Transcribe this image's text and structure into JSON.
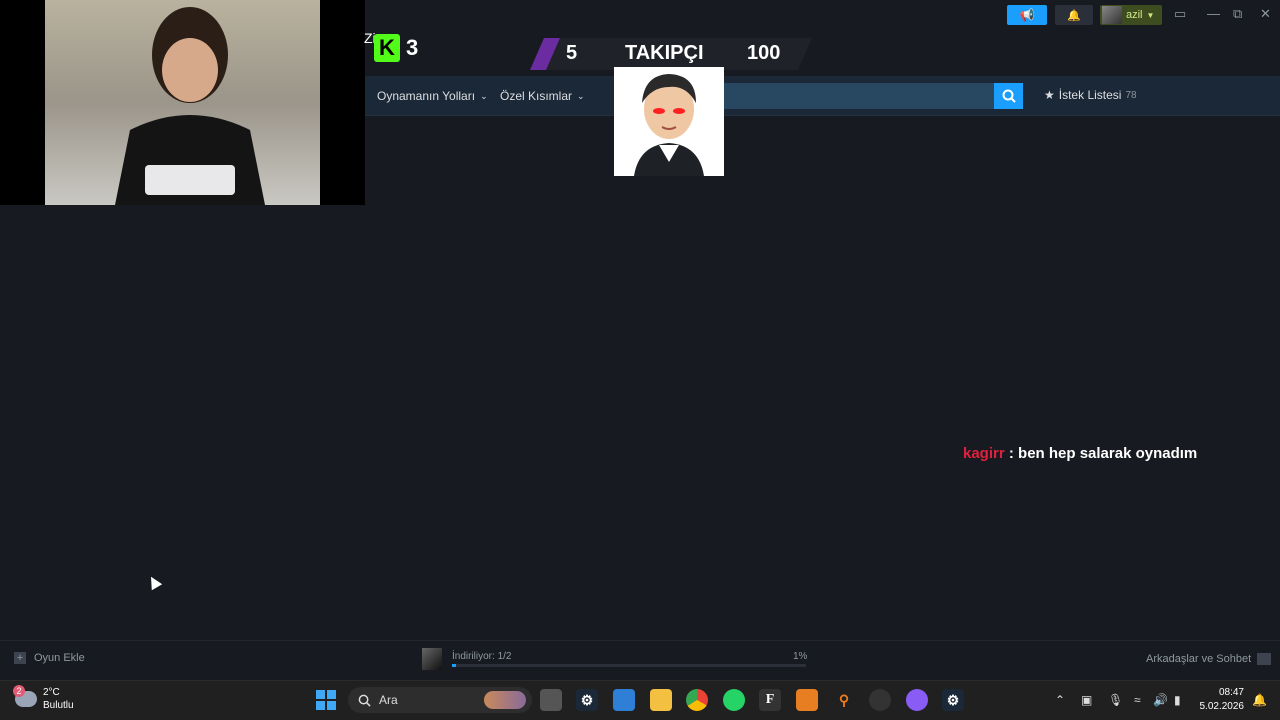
{
  "stream_overlay": {
    "kick_count": "3",
    "zi_text": "Zi",
    "follow_current": "5",
    "follow_label": "TAKIPÇI",
    "follow_goal": "100",
    "chat_nick": "kagirr",
    "chat_message": ": ben hep salarak oynadım"
  },
  "steam": {
    "user_name": "azil",
    "nav": {
      "item1": "Oynamanın Yolları",
      "item2": "Özel Kısımlar",
      "wishlist_label": "İstek Listesi",
      "wishlist_count": "78"
    },
    "bottom": {
      "add_game": "Oyun Ekle",
      "download_label": "İndiriliyor: 1/2",
      "download_percent": "1%",
      "download_progress": 0.01,
      "friends": "Arkadaşlar ve Sohbet"
    }
  },
  "taskbar": {
    "weather_temp": "2°C",
    "weather_desc": "Bulutlu",
    "weather_badge": "2",
    "search_placeholder": "Ara",
    "time": "08:47",
    "date": "5.02.2026"
  },
  "colors": {
    "steam_bg": "#171a21",
    "accent": "#1a9fff",
    "kick_green": "#53fc18",
    "chat_nick": "#e0213d"
  }
}
